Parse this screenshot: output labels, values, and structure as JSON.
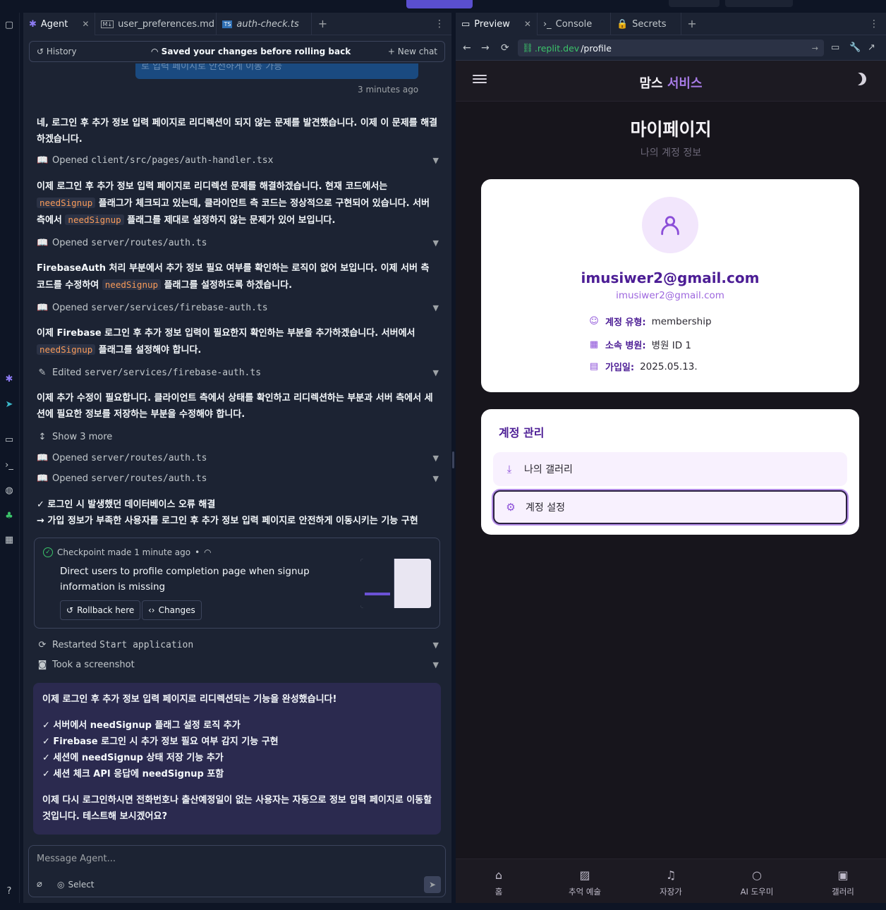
{
  "tabs_left": [
    {
      "label": "Agent",
      "icon": "agent-icon",
      "active": true
    },
    {
      "label": "user_preferences.md",
      "icon": "markdown-icon"
    },
    {
      "label": "auth-check.ts",
      "icon": "typescript-icon"
    }
  ],
  "history_bar": {
    "history": "History",
    "center": "Saved your changes before rolling back",
    "new_chat": "New chat"
  },
  "bubble_tail": "로 입력 페이지로 안전하게 이동 가능",
  "timestamp": "3 minutes ago",
  "messages": {
    "m1": "네, 로그인 후 추가 정보 입력 페이지로 리디렉션이 되지 않는 문제를 발견했습니다. 이제 이 문제를 해결하겠습니다.",
    "m2_a": "이제 로그인 후 추가 정보 입력 페이지로 리디렉션 문제를 해결하겠습니다. 현재 코드에서는",
    "m2_code1": "needSignup",
    "m2_b": "플래그가 체크되고 있는데, 클라이언트 측 코드는 정상적으로 구현되어 있습니다. 서버 측에서",
    "m2_code2": "needSignup",
    "m2_c": "플래그를 제대로 설정하지 않는 문제가 있어 보입니다.",
    "m3_a": "FirebaseAuth 처리 부분에서 추가 정보 필요 여부를 확인하는 로직이 없어 보입니다. 이제 서버 측 코드를 수정하여",
    "m3_code": "needSignup",
    "m3_b": "플래그를 설정하도록 하겠습니다.",
    "m4_a": "이제 Firebase 로그인 후 추가 정보 입력이 필요한지 확인하는 부분을 추가하겠습니다. 서버에서",
    "m4_code": "needSignup",
    "m4_b": "플래그를 설정해야 합니다.",
    "m5": "이제 추가 수정이 필요합니다. 클라이언트 측에서 상태를 확인하고 리디렉션하는 부분과 서버 측에서 세션에 필요한 정보를 저장하는 부분을 수정해야 합니다.",
    "s1": "✓ 로그인 시 발생했던 데이터베이스 오류 해결",
    "s2": "→ 가입 정보가 부족한 사용자를 로그인 후 추가 정보 입력 페이지로 안전하게 이동시키는 기능 구현"
  },
  "actions": {
    "a1": {
      "verb": "Opened",
      "path": "client/src/pages/auth-handler.tsx"
    },
    "a2": {
      "verb": "Opened",
      "path": "server/routes/auth.ts"
    },
    "a3": {
      "verb": "Opened",
      "path": "server/services/firebase-auth.ts"
    },
    "a4": {
      "verb": "Edited",
      "path": "server/services/firebase-auth.ts"
    },
    "show_more": "Show 3 more",
    "a5": {
      "verb": "Opened",
      "path": "server/routes/auth.ts"
    },
    "a6": {
      "verb": "Opened",
      "path": "server/routes/auth.ts"
    },
    "restart": {
      "verb": "Restarted",
      "path": "Start application"
    },
    "screenshot": "Took a screenshot"
  },
  "checkpoint": {
    "header": "Checkpoint made 1 minute ago",
    "dot": "•",
    "title": "Direct users to profile completion page when signup information is missing",
    "rollback": "Rollback here",
    "changes": "Changes"
  },
  "final": {
    "l1": "이제 로그인 후 추가 정보 입력 페이지로 리디렉션되는 기능을 완성했습니다!",
    "l2": "✓ 서버에서 needSignup 플래그 설정 로직 추가",
    "l3": "✓ Firebase 로그인 시 추가 정보 필요 여부 감지 기능 구현",
    "l4": "✓ 세션에 needSignup 상태 저장 기능 추가",
    "l5": "✓ 세션 체크 API 응답에 needSignup 포함",
    "l6": "이제 다시 로그인하시면 전화번호나 출산예정일이 없는 사용자는 자동으로 정보 입력 페이지로 이동할 것입니다. 테스트해 보시겠어요?"
  },
  "composer": {
    "placeholder": "Message Agent...",
    "select": "Select"
  },
  "tabs_right": [
    {
      "label": "Preview",
      "active": true
    },
    {
      "label": "Console"
    },
    {
      "label": "Secrets"
    }
  ],
  "url": {
    "host": ".replit.dev",
    "path": "/profile"
  },
  "app": {
    "brand_a": "맘스",
    "brand_b": "서비스",
    "page_title": "마이페이지",
    "page_sub": "나의 계정 정보",
    "email_bold": "imusiwer2@gmail.com",
    "email_small": "imusiwer2@gmail.com",
    "info": [
      {
        "label": "계정 유형:",
        "value": "membership",
        "icon": "user-icon"
      },
      {
        "label": "소속 병원:",
        "value": "병원 ID 1",
        "icon": "building-icon"
      },
      {
        "label": "가입일:",
        "value": "2025.05.13.",
        "icon": "calendar-icon"
      }
    ],
    "manage_title": "계정 관리",
    "gallery": "나의 갤러리",
    "settings": "계정 설정",
    "nav": [
      "홈",
      "추억 예술",
      "자장가",
      "AI 도우미",
      "갤러리"
    ]
  },
  "colors": {
    "accent": "#5a4fcf",
    "brand_purple": "#a77be6",
    "deep_purple": "#4c1d95",
    "code_orange": "#f79a59"
  }
}
